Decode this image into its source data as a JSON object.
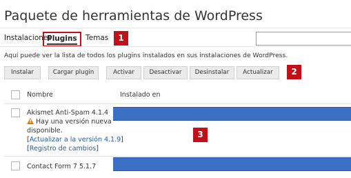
{
  "page": {
    "title": "Paquete de herramientas de WordPress"
  },
  "tabs": {
    "installs": "Instalaciones",
    "plugins": "Plugins",
    "themes": "Temas",
    "active": "plugins"
  },
  "search": {
    "value": "",
    "placeholder": ""
  },
  "description": "Aquí puede ver la lista de todos los plugins instalados en sus instalaciones de WordPress.",
  "toolbar": {
    "install": "Instalar",
    "upload": "Cargar plugin",
    "activate": "Activar",
    "deactivate": "Desactivar",
    "uninstall": "Desinstalar",
    "update": "Actualizar"
  },
  "table": {
    "columns": {
      "name": "Nombre",
      "installed": "Instalado en"
    },
    "rows": [
      {
        "name": "Akismet Anti-Spam 4.1.4",
        "update_notice": "Hay una versión nueva disponible.",
        "update_link": "Actualizar a la versión 4.1.9",
        "changelog_link": "Registro de cambios",
        "checked": false
      },
      {
        "name": "Contact Form 7 5.1.7",
        "checked": false
      }
    ]
  },
  "markers": {
    "one": "1",
    "two": "2",
    "three": "3"
  },
  "colors": {
    "marker_red": "#c0101a",
    "redaction_blue": "#3a6fc4",
    "link_blue": "#1a5ea8",
    "warning_orange": "#e07b00"
  },
  "icons": {
    "warning": "warning-triangle-icon"
  }
}
